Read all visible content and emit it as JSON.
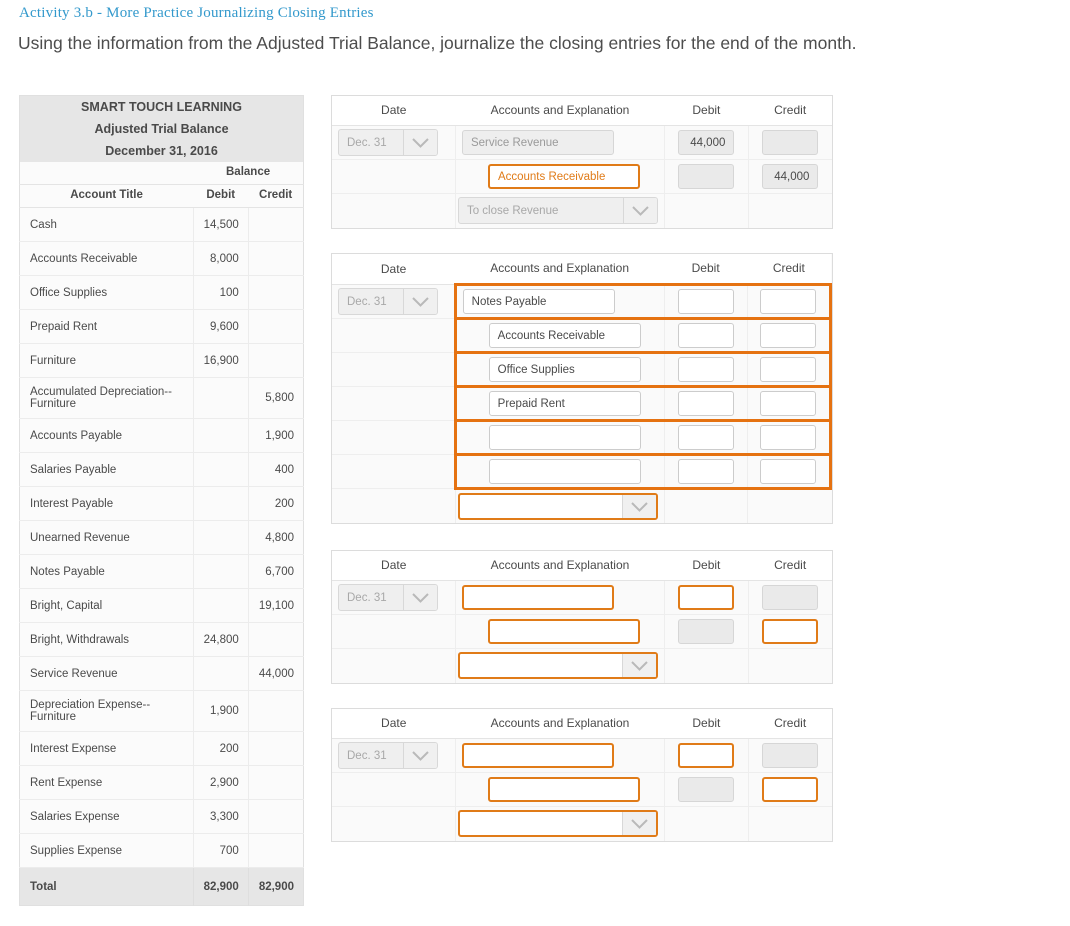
{
  "header": {
    "activity_title": "Activity 3.b - More Practice Journalizing Closing Entries",
    "instruction": "Using the information from the Adjusted Trial Balance, journalize the closing entries for the end of the month.",
    "title_color": "#3399cc"
  },
  "accent": {
    "orange": "#e57211",
    "orange_text": "#e07b18"
  },
  "trial_balance": {
    "company": "SMART TOUCH LEARNING",
    "statement": "Adjusted Trial Balance",
    "date": "December 31, 2016",
    "balance_label": "Balance",
    "columns": {
      "title": "Account Title",
      "debit": "Debit",
      "credit": "Credit"
    },
    "rows": [
      {
        "title": "Cash",
        "debit": "14,500",
        "credit": ""
      },
      {
        "title": "Accounts Receivable",
        "debit": "8,000",
        "credit": ""
      },
      {
        "title": "Office Supplies",
        "debit": "100",
        "credit": ""
      },
      {
        "title": "Prepaid Rent",
        "debit": "9,600",
        "credit": ""
      },
      {
        "title": "Furniture",
        "debit": "16,900",
        "credit": ""
      },
      {
        "title": "Accumulated Depreciation--Furniture",
        "debit": "",
        "credit": "5,800"
      },
      {
        "title": "Accounts Payable",
        "debit": "",
        "credit": "1,900"
      },
      {
        "title": "Salaries Payable",
        "debit": "",
        "credit": "400"
      },
      {
        "title": "Interest Payable",
        "debit": "",
        "credit": "200"
      },
      {
        "title": "Unearned Revenue",
        "debit": "",
        "credit": "4,800"
      },
      {
        "title": "Notes Payable",
        "debit": "",
        "credit": "6,700"
      },
      {
        "title": "Bright, Capital",
        "debit": "",
        "credit": "19,100"
      },
      {
        "title": "Bright, Withdrawals",
        "debit": "24,800",
        "credit": ""
      },
      {
        "title": "Service Revenue",
        "debit": "",
        "credit": "44,000"
      },
      {
        "title": "Depreciation Expense--Furniture",
        "debit": "1,900",
        "credit": ""
      },
      {
        "title": "Interest Expense",
        "debit": "200",
        "credit": ""
      },
      {
        "title": "Rent Expense",
        "debit": "2,900",
        "credit": ""
      },
      {
        "title": "Salaries Expense",
        "debit": "3,300",
        "credit": ""
      },
      {
        "title": "Supplies Expense",
        "debit": "700",
        "credit": ""
      }
    ],
    "total": {
      "label": "Total",
      "debit": "82,900",
      "credit": "82,900"
    }
  },
  "journal_columns": {
    "date": "Date",
    "accounts": "Accounts and Explanation",
    "debit": "Debit",
    "credit": "Credit"
  },
  "journals": [
    {
      "date_value": "Dec. 31",
      "rows": [
        {
          "account": "Service Revenue",
          "debit": "44,000",
          "credit": ""
        },
        {
          "account": "Accounts Receivable",
          "debit": "",
          "credit": "44,000"
        }
      ],
      "explanation": "To close Revenue"
    },
    {
      "date_value": "Dec. 31",
      "rows": [
        {
          "account": "Notes Payable",
          "debit": "",
          "credit": ""
        },
        {
          "account": "Accounts Receivable",
          "debit": "",
          "credit": ""
        },
        {
          "account": "Office Supplies",
          "debit": "",
          "credit": ""
        },
        {
          "account": "Prepaid Rent",
          "debit": "",
          "credit": ""
        },
        {
          "account": "",
          "debit": "",
          "credit": ""
        },
        {
          "account": "",
          "debit": "",
          "credit": ""
        }
      ],
      "explanation": ""
    },
    {
      "date_value": "Dec. 31",
      "rows": [
        {
          "account": "",
          "debit": "",
          "credit": ""
        },
        {
          "account": "",
          "debit": "",
          "credit": ""
        }
      ],
      "explanation": ""
    },
    {
      "date_value": "Dec. 31",
      "rows": [
        {
          "account": "",
          "debit": "",
          "credit": ""
        },
        {
          "account": "",
          "debit": "",
          "credit": ""
        }
      ],
      "explanation": ""
    }
  ]
}
